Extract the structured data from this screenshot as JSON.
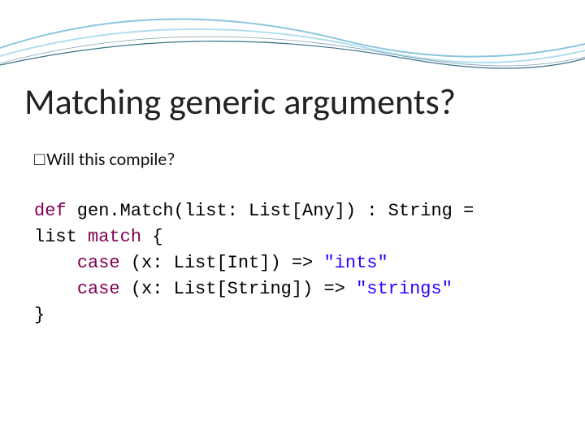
{
  "title": "Matching generic arguments?",
  "bullet_mark": "□",
  "bullets": [
    "Will this compile?"
  ],
  "code": {
    "l1": {
      "a": "def",
      "b": " gen.Match(list: List[Any]) : String ="
    },
    "l2": {
      "a": "list ",
      "b": "match",
      "c": " {"
    },
    "l3": {
      "a": "    ",
      "b": "case",
      "c": " (x: List[Int]) => ",
      "d": "\"ints\""
    },
    "l4": {
      "a": "    ",
      "b": "case",
      "c": " (x: List[String]) => ",
      "d": "\"strings\""
    },
    "l5": {
      "a": "}"
    }
  }
}
